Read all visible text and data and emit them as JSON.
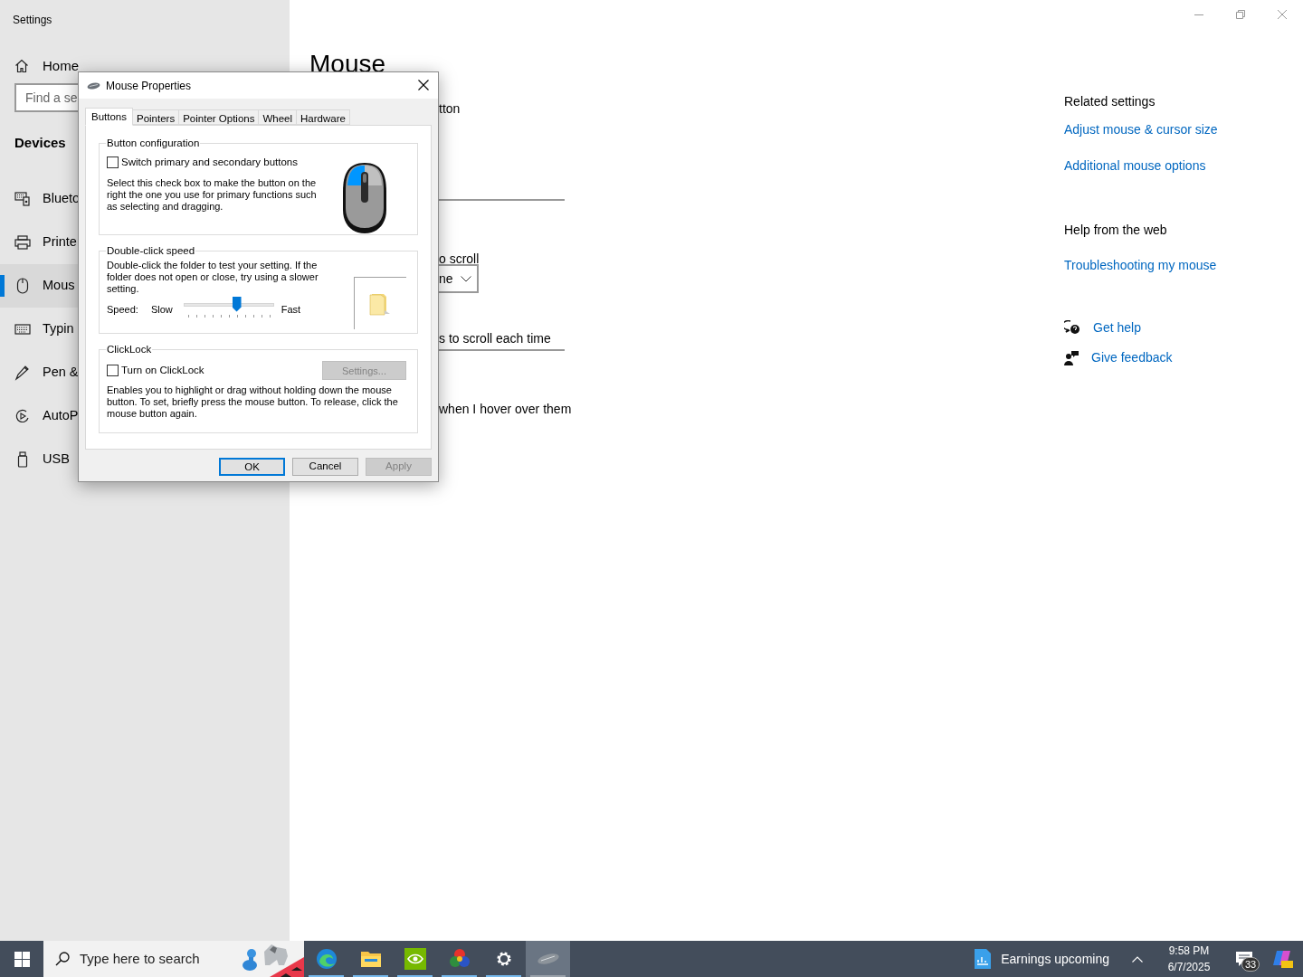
{
  "window": {
    "title": "Settings"
  },
  "sidebar": {
    "home": "Home",
    "search": {
      "placeholder": "Find a se"
    },
    "section": "Devices",
    "items": [
      {
        "label": "Blueto",
        "selected": false
      },
      {
        "label": "Printe",
        "selected": false
      },
      {
        "label": "Mous",
        "selected": true
      },
      {
        "label": "Typin",
        "selected": false
      },
      {
        "label": "Pen &",
        "selected": false
      },
      {
        "label": "AutoP",
        "selected": false
      },
      {
        "label": "USB",
        "selected": false
      }
    ]
  },
  "main": {
    "title": "Mouse",
    "fragments": [
      {
        "kind": "text",
        "text": "tton"
      },
      {
        "kind": "divider"
      },
      {
        "kind": "text",
        "text": "o scroll"
      },
      {
        "kind": "dropdown",
        "text": "ne"
      },
      {
        "kind": "text",
        "text": "s to scroll each time"
      },
      {
        "kind": "divider"
      },
      {
        "kind": "text",
        "text": "when I hover over them"
      }
    ]
  },
  "related": {
    "heading": "Related settings",
    "links": [
      "Adjust mouse & cursor size",
      "Additional mouse options"
    ],
    "help_heading": "Help from the web",
    "help_links": [
      "Troubleshooting my mouse"
    ],
    "actions": [
      "Get help",
      "Give feedback"
    ]
  },
  "dialog": {
    "title": "Mouse Properties",
    "tabs": [
      {
        "label": "Buttons",
        "selected": true
      },
      {
        "label": "Pointers",
        "selected": false
      },
      {
        "label": "Pointer Options",
        "selected": false
      },
      {
        "label": "Wheel",
        "selected": false
      },
      {
        "label": "Hardware",
        "selected": false
      }
    ],
    "button_configuration": {
      "title": "Button configuration",
      "checkbox": {
        "label": "Switch primary and secondary buttons",
        "checked": false
      },
      "description": "Select this check box to make the button on the right the one you use for primary functions such as selecting and dragging."
    },
    "double_click": {
      "title": "Double-click speed",
      "description": "Double-click the folder to test your setting. If the folder does not open or close, try using a slower setting.",
      "speed_label": "Speed:",
      "slow": "Slow",
      "fast": "Fast",
      "level": 0.59
    },
    "clicklock": {
      "title": "ClickLock",
      "checkbox": {
        "label": "Turn on ClickLock",
        "checked": false
      },
      "settings_button": {
        "label": "Settings...",
        "disabled": true
      },
      "description": "Enables you to highlight or drag without holding down the mouse button. To set, briefly press the mouse button. To release, click the mouse button again."
    },
    "buttons": [
      {
        "label": "OK",
        "disabled": false
      },
      {
        "label": "Cancel",
        "disabled": false
      },
      {
        "label": "Apply",
        "disabled": true
      }
    ]
  },
  "taskbar": {
    "search_placeholder": "Type here to search",
    "apps": [
      {
        "kind": "edge",
        "selected": false
      },
      {
        "kind": "explorer",
        "selected": false
      },
      {
        "kind": "nvidia",
        "selected": false
      },
      {
        "kind": "color",
        "selected": false
      },
      {
        "kind": "settings",
        "selected": false
      },
      {
        "kind": "mouse",
        "selected": true
      }
    ],
    "widget": "Earnings upcoming",
    "time": "9:58 PM",
    "date": "6/7/2025",
    "notifications": "33"
  }
}
